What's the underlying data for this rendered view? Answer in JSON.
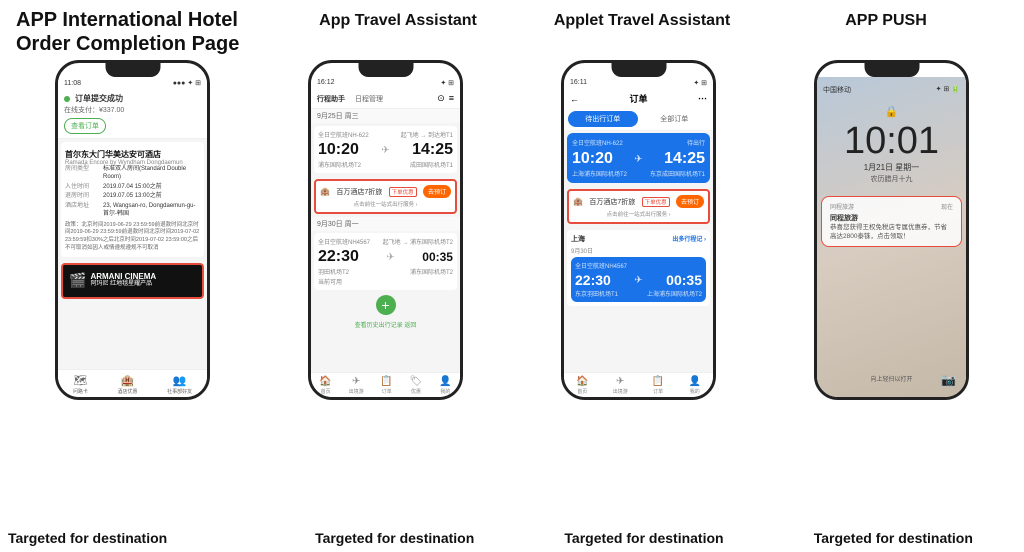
{
  "header": {
    "app_title": "APP International Hotel",
    "page_subtitle": "Order Completion Page",
    "col2_title": "App Travel Assistant",
    "col3_title": "Applet Travel Assistant",
    "col4_title": "APP PUSH"
  },
  "footer": {
    "col1_text": "Targeted for destination",
    "col2_text": "Targeted for destination",
    "col3_text": "Targeted for destination",
    "col4_text": "Targeted for destination"
  },
  "phone1": {
    "time": "11:08",
    "complete_text": "订单提交成功",
    "price_text": "在线支付：¥337.00",
    "view_order_btn": "查看订单",
    "hotel_name": "首尔东大门华美达安可酒店",
    "hotel_sub": "Ramada Encore by Wyndham Dongdaemun",
    "row1_label": "房间类型",
    "row1_value": "标准双人房间(Standard Double Room)",
    "row2_label": "入住时间",
    "row2_value": "2019.07.04 15:00之前",
    "row3_label": "退房时间",
    "row3_value": "2019.07.05 13:00之前",
    "row4_label": "酒店地址",
    "row4_value": "23, Wangsan-ro, Dongdaemun-gu-首尔-韩国",
    "notice_text": "政策：北京时间2019-06-29 23:59:59前退款时间北京时间2019-06-29 23:59:59前退款时间北京时间2019-07-02 23:59:59扣30%之后北京时间2019-07-02 23:59:00之后不可取消如因人或情遵规遵规不可取消",
    "ad_title": "ARMANI CINEMA",
    "ad_sub": "阿玛尼 红地毯星耀产品",
    "nav_items": [
      "问路卡",
      "酒店优惠",
      "社事部好友"
    ]
  },
  "phone2": {
    "time": "16:12",
    "header_title": "行程助手",
    "tab1": "日程管理",
    "icons": [
      "⊙",
      "≡"
    ],
    "date1": "9月25日 周三",
    "flight1_no": "全日空航班NH-622",
    "flight1_dep_label": "起飞地",
    "flight1_arr_label": "到达地T1",
    "flight1_dep_time": "10:20",
    "flight1_arr_time": "14:25",
    "flight1_dep_airport": "浦东国际机场T2",
    "flight1_arr_airport": "成田国际机场T1",
    "hotel_icon": "🏨",
    "hotel_name": "百万酒店7折旅",
    "hotel_tag": "下单优惠",
    "book_btn": "去预订",
    "click_hint": "点击前往一站式出行服务 ›",
    "date2": "9月30日 周一",
    "flight2_no": "全日空航班NH4567",
    "flight2_dep_label": "起飞地",
    "flight2_arr_label": "浦东国际机场T2",
    "flight2_dep_time": "22:30",
    "flight2_arr_time": "00:35",
    "flight2_dep_airport": "羽田机场T2",
    "flight2_arr_airport": "浦东国际机场T2",
    "flight2_status": "当前可用",
    "history_text": "查看历史出行记录 返回",
    "nav_items": [
      "首页",
      "出境游",
      "订单",
      "优惠",
      "我的"
    ]
  },
  "phone3": {
    "time": "16:11",
    "header_title": "订单",
    "tab1": "待出行订单",
    "tab2": "全部订单",
    "flight1_no": "全日空航班NH-622",
    "flight1_status": "待出行",
    "flight1_dep_time": "10:20",
    "flight1_arr_time": "14:25",
    "flight1_dep_airport": "上海浦东国际机场T2",
    "flight1_arr_airport": "东京成田国际机场T1",
    "hotel_icon": "🏨",
    "hotel_name": "百万酒店7折旅",
    "hotel_tag": "下单优惠",
    "book_btn": "去预订",
    "click_hint": "点击前往一站式出行服务 ›",
    "city_section": "上海",
    "date_section": "9月30日",
    "link_text": "出多行程记 ›",
    "flight2_no": "全日空航班NH4567",
    "flight2_dep_time": "22:30",
    "flight2_arr_time": "00:35",
    "flight2_dep_airport": "东京羽田机场T1",
    "flight2_arr_airport": "上海浦东国际机场T2",
    "nav_items": [
      "首页",
      "出境游",
      "订单",
      "我的"
    ]
  },
  "phone4": {
    "carrier": "中国移动",
    "time_large": "10:01",
    "date": "1月21日 星期一",
    "lunar": "农历腊月十九",
    "notif_app": "同程旅游",
    "notif_close": "现在",
    "notif_title": "同程旅游",
    "notif_body": "恭喜您获得王权免税店专属优惠券，节省高达2800泰铢，点击领取！",
    "swipe_text": "向上轻扫以打开"
  }
}
